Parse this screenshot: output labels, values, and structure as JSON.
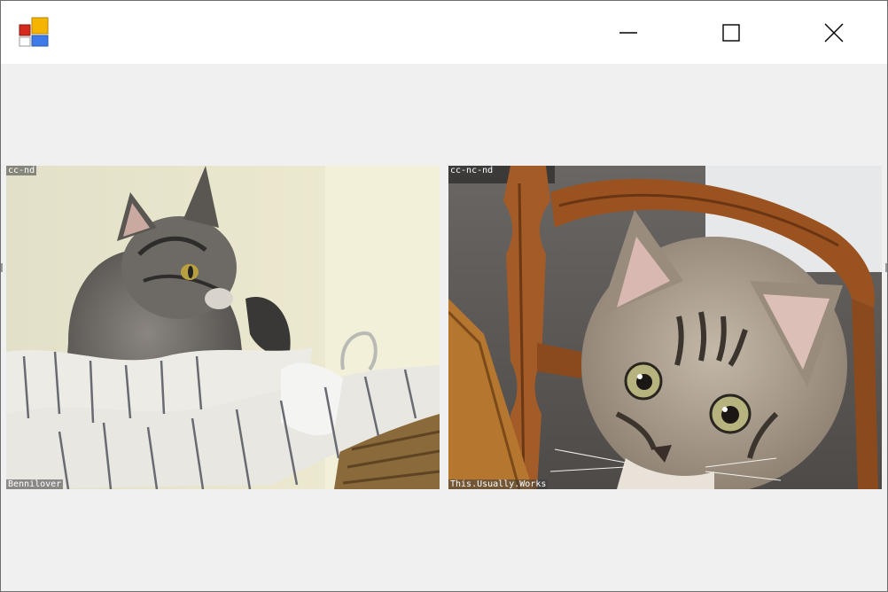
{
  "window": {
    "title": "",
    "controls": {
      "minimize_icon": "minimize-icon",
      "maximize_icon": "maximize-icon",
      "close_icon": "close-icon"
    }
  },
  "gallery": {
    "images": [
      {
        "license": "cc-nd",
        "author": "Bennilover",
        "subject": "tabby-cat-in-basket"
      },
      {
        "license": "cc-nc-nd",
        "author": "This.Usually.Works",
        "subject": "tabby-kitten-on-chair"
      }
    ]
  },
  "colors": {
    "titlebar_bg": "#ffffff",
    "client_bg": "#f0f0f0",
    "window_border": "#6e6e6e"
  }
}
